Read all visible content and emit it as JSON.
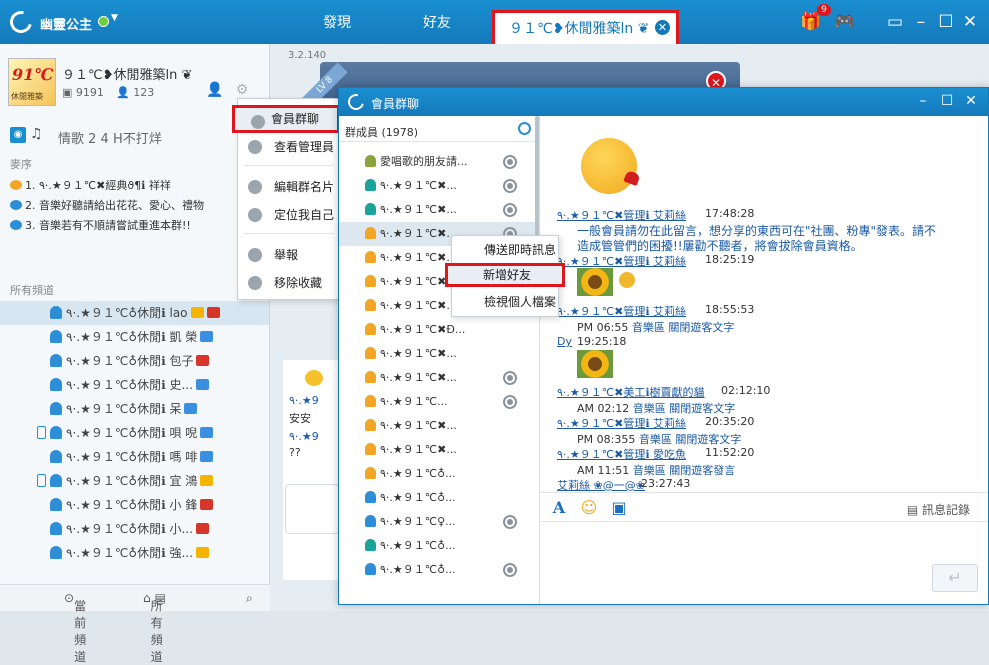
{
  "topbar": {
    "username": "幽靈公主",
    "tabs": [
      {
        "label": "發現"
      },
      {
        "label": "好友"
      }
    ],
    "active_room_tab": "９１℃❥休閒雅築ln ❦",
    "gift_badge": "9",
    "colors": {
      "primary": "#1479bb",
      "highlight": "#e0161d"
    }
  },
  "left": {
    "room": {
      "avatar_big": "91℃",
      "avatar_small": "休閒雅築",
      "name": "９１℃❥休閒雅築ln ❦",
      "id": "9191",
      "members": "123"
    },
    "music_title": "情歌 2 4 H不打烊",
    "queue_label": "麥序",
    "queue": [
      "1.  ٩·.★９１℃✖經典ϑ¶ℹ 祥祥",
      "2.  音樂好聽請給出花花、愛心、禮物",
      "3.  音樂若有不順請嘗試重進本群!!"
    ],
    "channels_label": "所有頻道",
    "channels": [
      "٩·.★９１℃♁休閒ℹ lao",
      "٩·.★９１℃♁休閒ℹ 凱 榮",
      "٩·.★９１℃♁休閒ℹ 包子",
      "٩·.★９１℃♁休閒ℹ 史...",
      "٩·.★９１℃♁休閒ℹ 呆",
      "٩·.★９１℃♁休閒ℹ 唄 唲",
      "٩·.★９１℃♁休閒ℹ 嗎 啡",
      "٩·.★９１℃♁休閒ℹ 宜 鴻",
      "٩·.★９１℃♁休閒ℹ 小 鋒",
      "٩·.★９１℃♁休閒ℹ 小...",
      "٩·.★９１℃♁休閒ℹ 強..."
    ],
    "footer": {
      "current": "當前頻道",
      "all": "所有頻道"
    }
  },
  "context_menu": {
    "items": [
      "會員群聊",
      "查看管理員",
      "編輯群名片",
      "定位我自己",
      "舉報",
      "移除收藏"
    ]
  },
  "center": {
    "version": "3.2.140",
    "lv": "LV 8",
    "chat_lines": [
      "٩·.★9",
      "安安",
      "٩·.★9",
      "??"
    ]
  },
  "member_window": {
    "title": "會員群聊",
    "members_header": "群成員 (1978)",
    "members": [
      "愛唱歌的朋友請...",
      "٩·.★９１℃✖...",
      "٩·.★９１℃✖...",
      "٩·.★９１℃✖...",
      "٩·.★９１℃✖...",
      "٩·.★９１℃✖...",
      "٩·.★９１℃✖...",
      "٩·.★９１℃✖Ð...",
      "٩·.★９１℃✖...",
      "٩·.★９１℃✖...",
      "٩·.★９１℃...",
      "٩·.★９１℃✖...",
      "٩·.★９１℃✖...",
      "٩·.★９１℃♁...",
      "٩·.★９１℃♁...",
      "٩·.★９１℃♀...",
      "٩·.★９１℃♁..."
    ],
    "sub_menu": [
      "傳送即時訊息",
      "新增好友",
      "檢視個人檔案"
    ],
    "chat": [
      {
        "name": "٩·.★９１℃✖管理ℹ 艾莉絲",
        "time": "17:48:28"
      },
      {
        "body1": "一般會員請勿在此留言，想分享的東西可在\"社團、粉專\"發表。請不"
      },
      {
        "body2": "造成管管們的困擾!!屢勸不聽者，將會拔除會員資格。"
      },
      {
        "name": "٩·.★９１℃✖管理ℹ 艾莉絲",
        "time": "18:25:19"
      },
      {
        "name": "٩·.★９１℃✖管理ℹ 艾莉絲",
        "time": "18:55:53"
      },
      {
        "sys_time": "PM 06:55",
        "sys_a": "音樂區",
        "sys_b": "關閉遊客文字"
      },
      {
        "name": "Dy",
        "time": "19:25:18"
      },
      {
        "name": "٩·.★９１℃✖美工ℹ樹賣獻的貓",
        "time": "02:12:10"
      },
      {
        "sys_time": "AM 02:12",
        "sys_a": "音樂區",
        "sys_b": "關閉遊客文字"
      },
      {
        "name": "٩·.★９１℃✖管理ℹ 艾莉絲",
        "time": "20:35:20"
      },
      {
        "sys_time": "PM 08:355",
        "sys_a": "音樂區",
        "sys_b": "關閉遊客文字"
      },
      {
        "name": "٩·.★９１℃✖管理ℹ 愛吃魚",
        "time": "11:52:20"
      },
      {
        "sys_time": "AM 11:51",
        "sys_a": "音樂區",
        "sys_b": "關閉遊客發言"
      },
      {
        "name": "艾莉絲 ❀@一@❀",
        "time": "23:27:43"
      }
    ],
    "toolbar_record": "訊息記錄"
  }
}
